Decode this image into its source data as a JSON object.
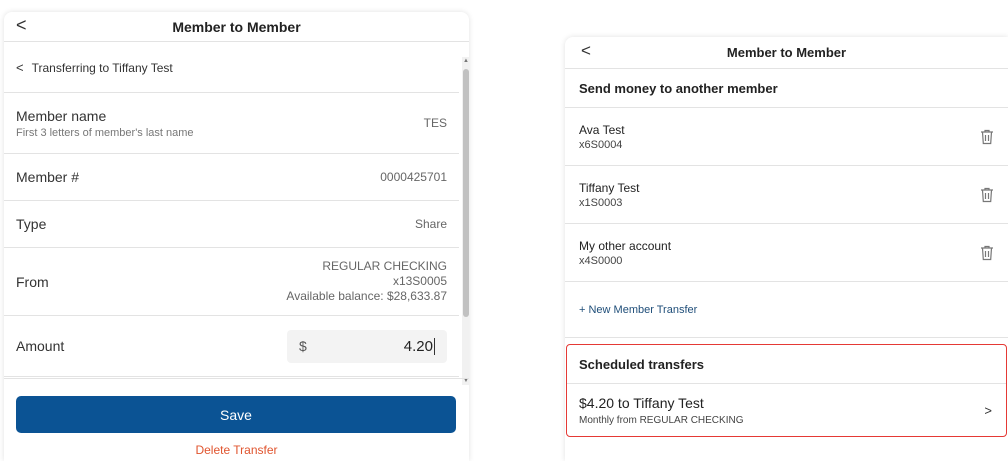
{
  "left": {
    "header": {
      "back_glyph": "<",
      "title": "Member to Member"
    },
    "breadcrumb": {
      "chevron": "<",
      "text": "Transferring to Tiffany Test"
    },
    "member_name": {
      "label": "Member name",
      "hint": "First 3 letters of member's last name",
      "value": "TES"
    },
    "member_number": {
      "label": "Member #",
      "value": "0000425701"
    },
    "type": {
      "label": "Type",
      "value": "Share"
    },
    "from": {
      "label": "From",
      "account": "REGULAR CHECKING",
      "account_number": "x13S0005",
      "balance": "Available balance: $28,633.87"
    },
    "amount": {
      "label": "Amount",
      "currency": "$",
      "value": "4.20"
    },
    "save_label": "Save",
    "delete_label": "Delete Transfer"
  },
  "right": {
    "header": {
      "back_glyph": "<",
      "title": "Member to Member"
    },
    "section_title": "Send money to another member",
    "accounts": [
      {
        "name": "Ava Test",
        "number": "x6S0004"
      },
      {
        "name": "Tiffany Test",
        "number": "x1S0003"
      },
      {
        "name": "My other account",
        "number": "x4S0000"
      }
    ],
    "new_transfer_label": "+ New Member Transfer",
    "scheduled": {
      "title": "Scheduled transfers",
      "item_title": "$4.20 to Tiffany Test",
      "item_subtitle": "Monthly from REGULAR CHECKING",
      "chevron": ">"
    }
  },
  "colors": {
    "primary": "#0b5394",
    "danger": "#e0542e",
    "highlight": "#e53935",
    "link": "#1f4e79"
  }
}
